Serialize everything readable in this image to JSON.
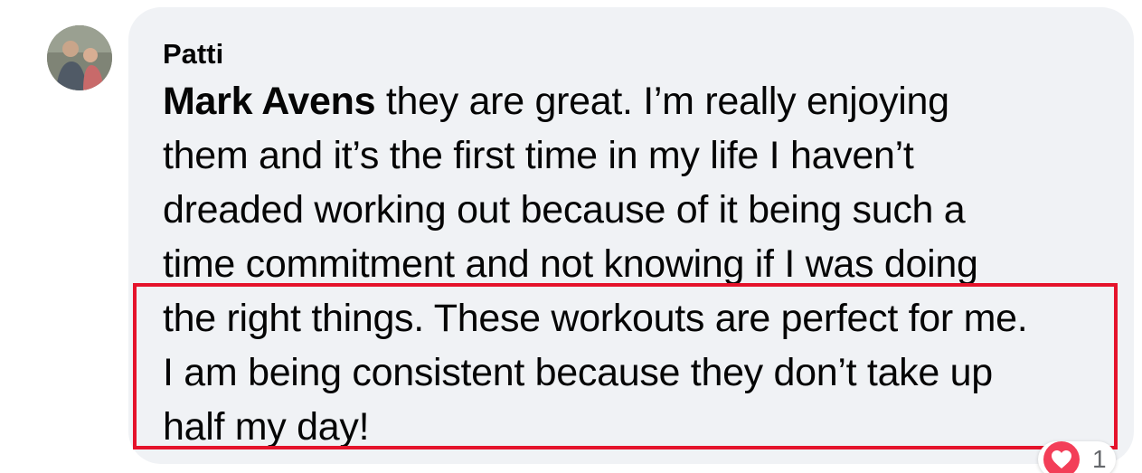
{
  "comment": {
    "author": "Patti",
    "mention": "Mark Avens",
    "lines": [
      " they are great. I’m really enjoying",
      "them and it’s the first time in my life I haven’t",
      "dreaded working out because of it being such a",
      "time commitment and not knowing if I was doing",
      "the right things. These workouts are perfect for me.",
      "I am being consistent because they don’t take up",
      "half my day!"
    ]
  },
  "reactions": {
    "icon": "heart-icon",
    "count": "1"
  },
  "colors": {
    "bubble": "#f0f2f5",
    "highlight_border": "#e5132b",
    "heart": "#f33e58",
    "text": "#050505"
  }
}
